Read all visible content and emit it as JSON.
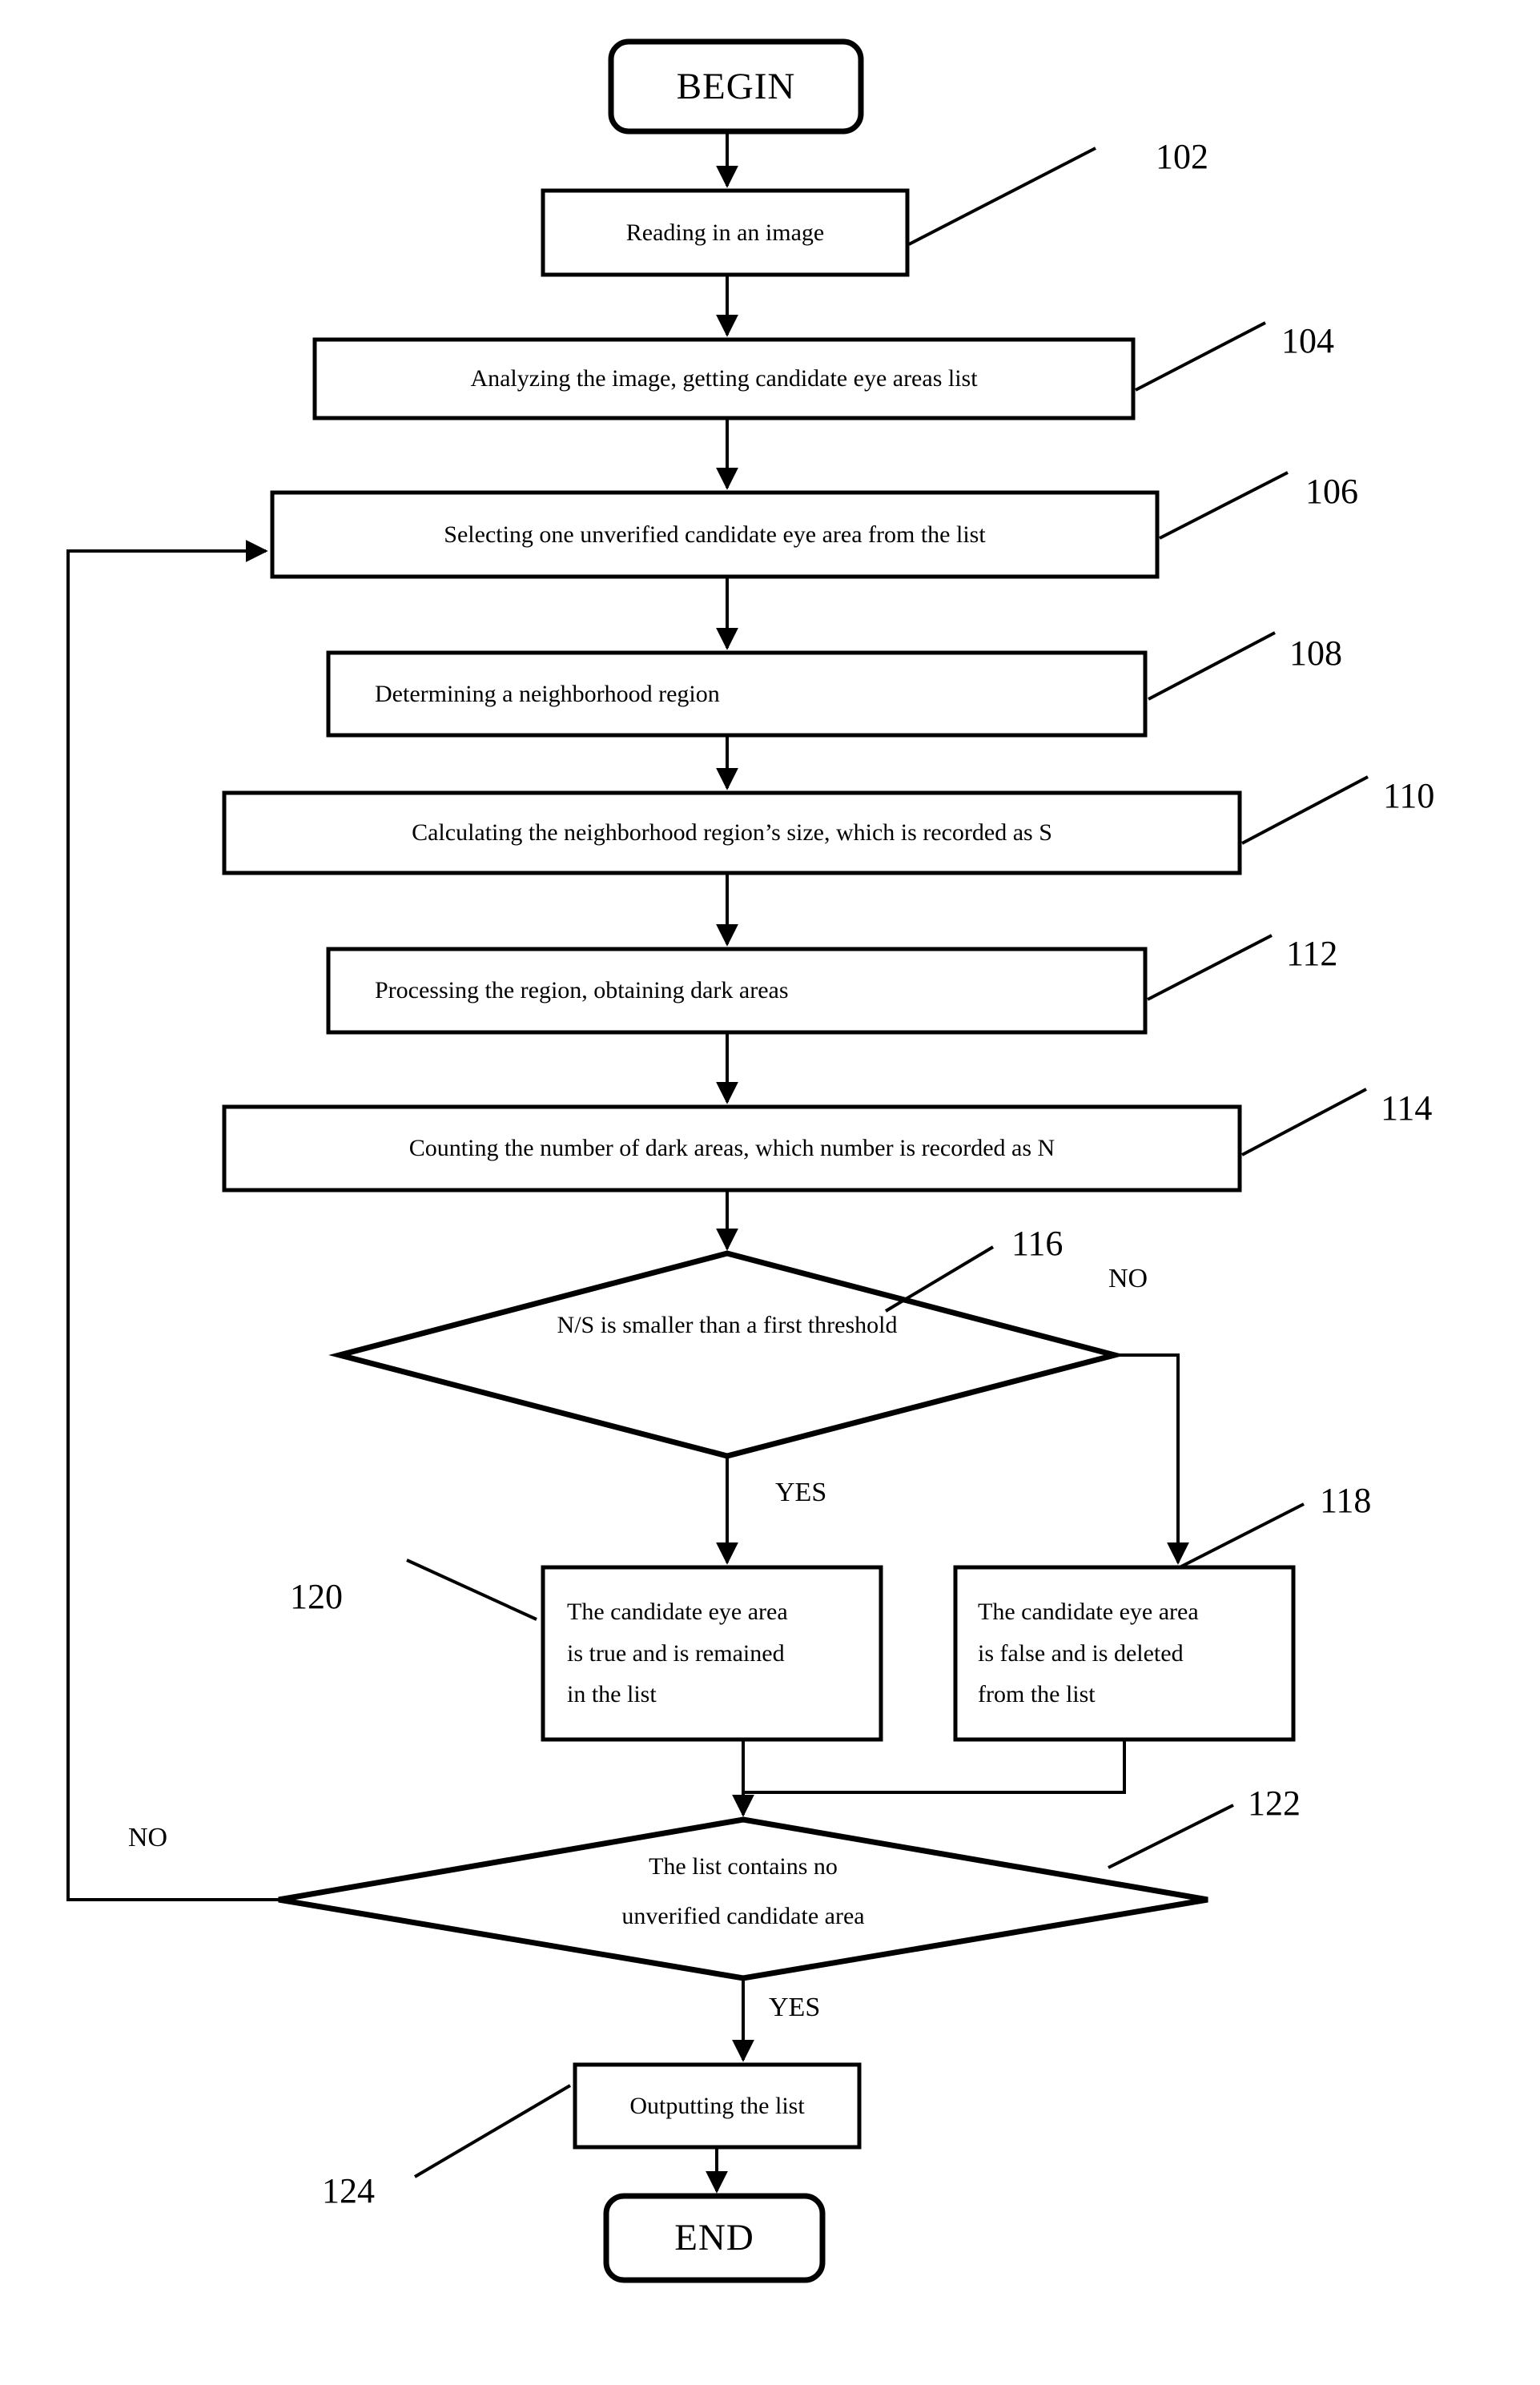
{
  "figure": {
    "type": "flowchart",
    "orientation": "vertical",
    "stroke_color": "#000000",
    "background_color": "#ffffff"
  },
  "nodes": {
    "begin": {
      "label": "BEGIN",
      "shape": "rounded-terminal"
    },
    "n102": {
      "label": "Reading in an image",
      "shape": "process",
      "ref": "102"
    },
    "n104": {
      "label": "Analyzing the image, getting candidate eye areas list",
      "shape": "process",
      "ref": "104"
    },
    "n106": {
      "label": "Selecting one unverified candidate eye area from the list",
      "shape": "process",
      "ref": "106"
    },
    "n108": {
      "label": "Determining a neighborhood region",
      "shape": "process",
      "ref": "108"
    },
    "n110": {
      "label": "Calculating the neighborhood region’s size, which is recorded as S",
      "shape": "process",
      "ref": "110"
    },
    "n112": {
      "label": "Processing the region, obtaining dark areas",
      "shape": "process",
      "ref": "112"
    },
    "n114": {
      "label": "Counting the number of dark areas, which number is recorded as N",
      "shape": "process",
      "ref": "114"
    },
    "n116": {
      "label": "N/S is smaller than a first threshold",
      "shape": "decision",
      "ref": "116"
    },
    "n120": {
      "lines": [
        "The candidate eye area",
        "is true and is remained",
        "in the list"
      ],
      "shape": "process",
      "ref": "120"
    },
    "n118": {
      "lines": [
        "The candidate eye area",
        "is false and is deleted",
        "from the list"
      ],
      "shape": "process",
      "ref": "118"
    },
    "n122": {
      "lines": [
        "The list contains no",
        "unverified candidate area"
      ],
      "shape": "decision",
      "ref": "122"
    },
    "n124": {
      "label": "Outputting the list",
      "shape": "process",
      "ref": "124"
    },
    "end": {
      "label": "END",
      "shape": "rounded-terminal"
    }
  },
  "ref_numbers": {
    "r102": "102",
    "r104": "104",
    "r106": "106",
    "r108": "108",
    "r110": "110",
    "r112": "112",
    "r114": "114",
    "r116": "116",
    "r118": "118",
    "r120": "120",
    "r122": "122",
    "r124": "124"
  },
  "edge_labels": {
    "d116_no": "NO",
    "d116_yes": "YES",
    "d122_no": "NO",
    "d122_yes": "YES"
  },
  "flow": [
    {
      "from": "begin",
      "to": "n102",
      "label": ""
    },
    {
      "from": "n102",
      "to": "n104",
      "label": ""
    },
    {
      "from": "n104",
      "to": "n106",
      "label": ""
    },
    {
      "from": "n106",
      "to": "n108",
      "label": ""
    },
    {
      "from": "n108",
      "to": "n110",
      "label": ""
    },
    {
      "from": "n110",
      "to": "n112",
      "label": ""
    },
    {
      "from": "n112",
      "to": "n114",
      "label": ""
    },
    {
      "from": "n114",
      "to": "n116",
      "label": ""
    },
    {
      "from": "n116",
      "to": "n120",
      "label": "YES"
    },
    {
      "from": "n116",
      "to": "n118",
      "label": "NO"
    },
    {
      "from": "n120",
      "to": "n122",
      "label": ""
    },
    {
      "from": "n118",
      "to": "n122",
      "label": ""
    },
    {
      "from": "n122",
      "to": "n106",
      "label": "NO"
    },
    {
      "from": "n122",
      "to": "n124",
      "label": "YES"
    },
    {
      "from": "n124",
      "to": "end",
      "label": ""
    }
  ]
}
